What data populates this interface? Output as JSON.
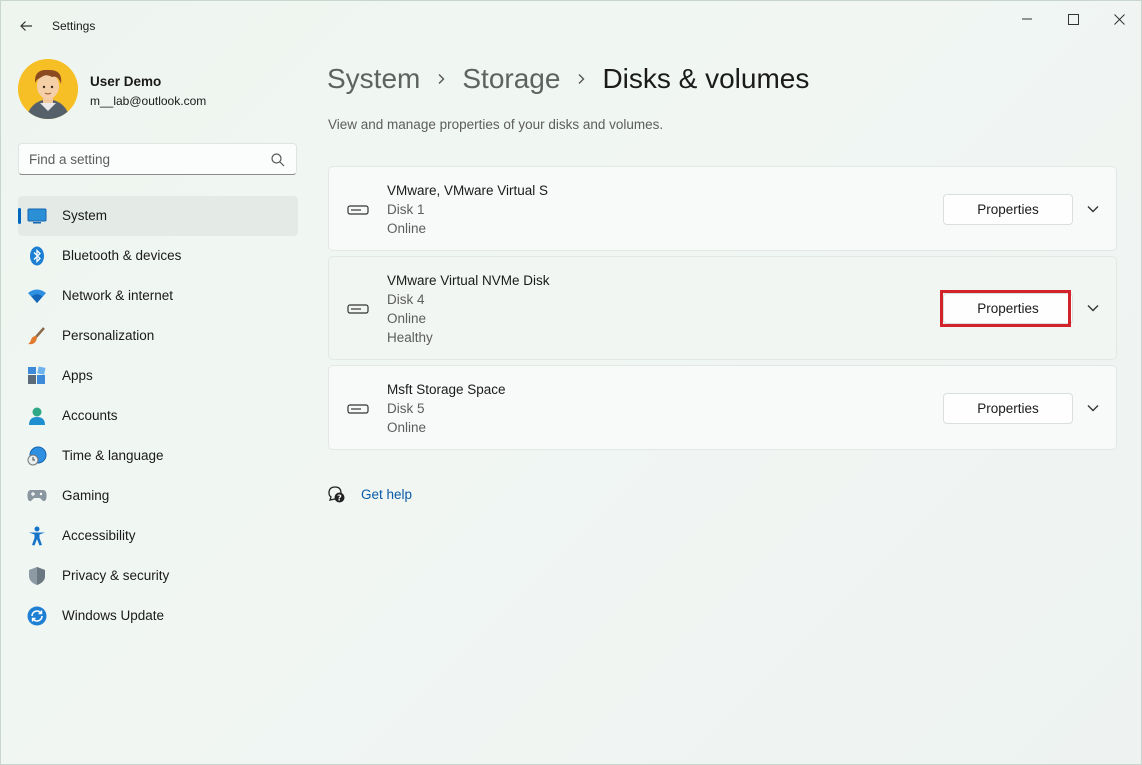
{
  "window": {
    "title": "Settings"
  },
  "profile": {
    "name": "User Demo",
    "email": "m__lab@outlook.com"
  },
  "search": {
    "placeholder": "Find a setting"
  },
  "sidebar": {
    "items": [
      {
        "label": "System",
        "icon": "system-icon",
        "selected": true
      },
      {
        "label": "Bluetooth & devices",
        "icon": "bluetooth-icon"
      },
      {
        "label": "Network & internet",
        "icon": "wifi-icon"
      },
      {
        "label": "Personalization",
        "icon": "brush-icon"
      },
      {
        "label": "Apps",
        "icon": "apps-icon"
      },
      {
        "label": "Accounts",
        "icon": "accounts-icon"
      },
      {
        "label": "Time & language",
        "icon": "time-language-icon"
      },
      {
        "label": "Gaming",
        "icon": "gamepad-icon"
      },
      {
        "label": "Accessibility",
        "icon": "accessibility-icon"
      },
      {
        "label": "Privacy & security",
        "icon": "shield-icon"
      },
      {
        "label": "Windows Update",
        "icon": "windows-update-icon"
      }
    ]
  },
  "breadcrumb": {
    "items": [
      "System",
      "Storage",
      "Disks & volumes"
    ]
  },
  "page": {
    "subtitle": "View and manage properties of your disks and volumes."
  },
  "disks": [
    {
      "name": "VMware, VMware Virtual S",
      "lines": [
        "Disk 1",
        "Online"
      ],
      "button": "Properties"
    },
    {
      "name": "VMware Virtual NVMe Disk",
      "lines": [
        "Disk 4",
        "Online",
        "Healthy"
      ],
      "button": "Properties",
      "highlighted": true
    },
    {
      "name": "Msft Storage Space",
      "lines": [
        "Disk 5",
        "Online"
      ],
      "button": "Properties"
    }
  ],
  "help": {
    "label": "Get help"
  },
  "colors": {
    "accent": "#0067c0",
    "highlight": "#d2232a",
    "link": "#0a5aa8"
  }
}
